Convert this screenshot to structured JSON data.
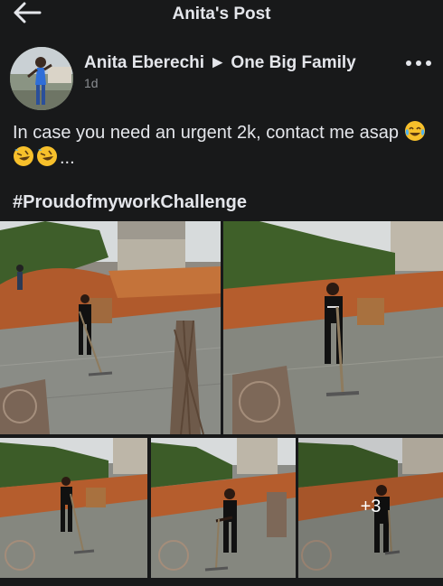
{
  "topbar": {
    "title": "Anita's Post",
    "back_icon": "back-arrow-icon"
  },
  "post": {
    "author": "Anita Eberechi",
    "separator": "►",
    "group": "One Big Family",
    "timestamp": "1d",
    "more_icon": "more-options-icon",
    "text": "In case you need an urgent 2k, contact me asap",
    "text_suffix": "...",
    "emojis": [
      "tears-of-joy-emoji",
      "rofl-emoji",
      "rofl-emoji"
    ],
    "hashtag": "#ProudofmyworkChallenge"
  },
  "photos": {
    "count": 5,
    "more_label": "+3"
  },
  "colors": {
    "background": "#18191a",
    "text": "#e4e6eb",
    "secondary_text": "#8a8d91"
  }
}
